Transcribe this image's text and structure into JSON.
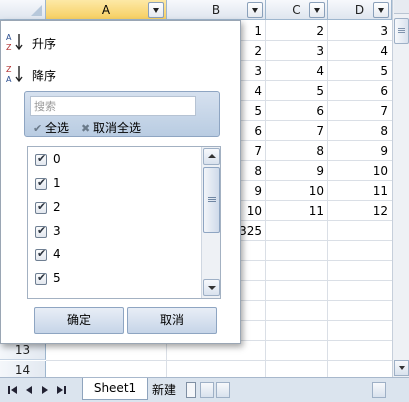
{
  "columns": [
    {
      "letter": "A",
      "selected": true
    },
    {
      "letter": "B",
      "selected": false
    },
    {
      "letter": "C",
      "selected": false
    },
    {
      "letter": "D",
      "selected": false
    }
  ],
  "row_numbers_visible": [
    "13",
    "14"
  ],
  "cells": {
    "col_b": [
      "1",
      "2",
      "3",
      "4",
      "5",
      "6",
      "7",
      "8",
      "9",
      "10"
    ],
    "col_c": [
      "2",
      "3",
      "4",
      "5",
      "6",
      "7",
      "8",
      "9",
      "10",
      "11"
    ],
    "col_d": [
      "3",
      "4",
      "5",
      "6",
      "7",
      "8",
      "9",
      "10",
      "11",
      "12"
    ],
    "total_partial": "325"
  },
  "filter_popup": {
    "sort_asc_label": "升序",
    "sort_desc_label": "降序",
    "search_placeholder": "搜索",
    "select_all_label": "全选",
    "deselect_all_label": "取消全选",
    "options": [
      {
        "label": "0",
        "checked": true
      },
      {
        "label": "1",
        "checked": true
      },
      {
        "label": "2",
        "checked": true
      },
      {
        "label": "3",
        "checked": true
      },
      {
        "label": "4",
        "checked": true
      },
      {
        "label": "5",
        "checked": true
      }
    ],
    "ok_label": "确定",
    "cancel_label": "取消"
  },
  "tabs": {
    "sheet1": "Sheet1",
    "new_tab": "新建"
  },
  "colors": {
    "selected_header": "#f7cf62",
    "header_border": "#9eb6ce",
    "chart_yellow": "#e8d400",
    "chart_green": "#3b8a1e"
  }
}
